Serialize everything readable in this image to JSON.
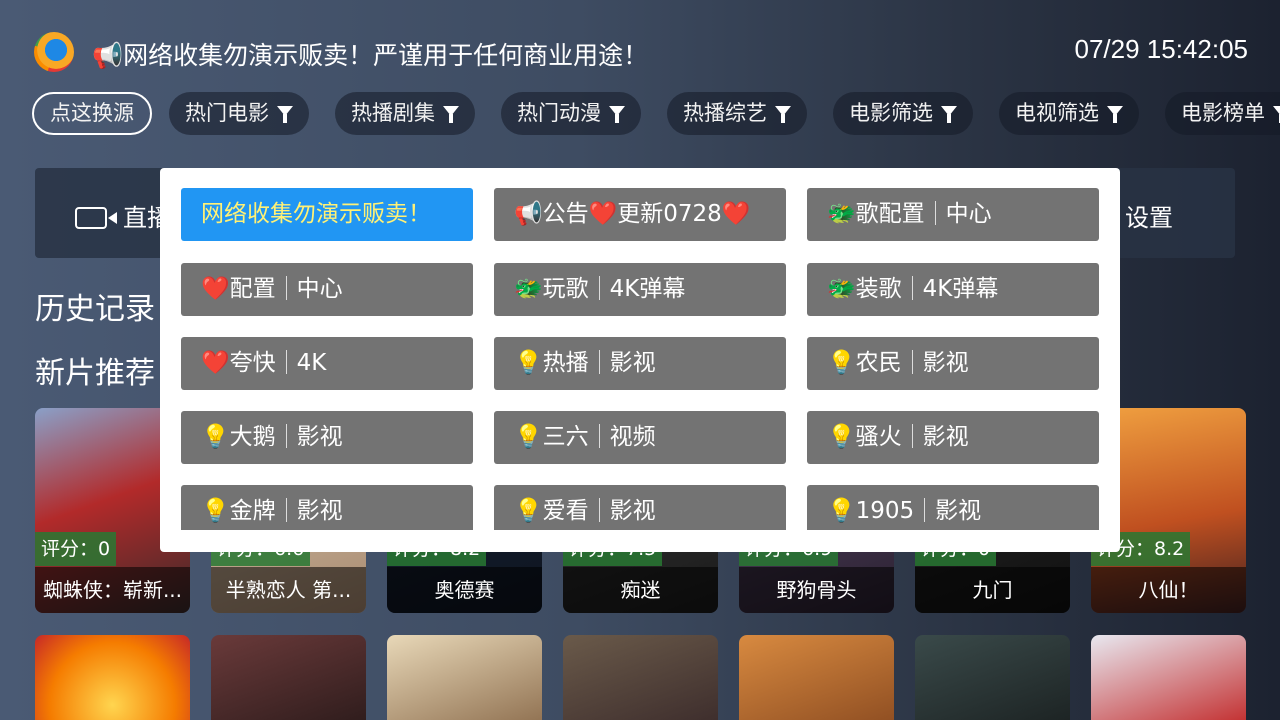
{
  "header": {
    "notice": "📢网络收集勿演示贩卖！严谨用于任何商业用途！",
    "clock": "07/29 15:42:05"
  },
  "tabs": [
    {
      "label": "点这换源",
      "filter": false
    },
    {
      "label": "热门电影",
      "filter": true
    },
    {
      "label": "热播剧集",
      "filter": true
    },
    {
      "label": "热门动漫",
      "filter": true
    },
    {
      "label": "热播综艺",
      "filter": true
    },
    {
      "label": "电影筛选",
      "filter": true
    },
    {
      "label": "电视筛选",
      "filter": true
    },
    {
      "label": "电影榜单",
      "filter": true
    }
  ],
  "navbar": {
    "live": "直播",
    "settings": "设置"
  },
  "sections": {
    "history": "历史记录",
    "new": "新片推荐"
  },
  "cards": [
    {
      "title": "蜘蛛侠：崭新...",
      "rating": "评分：0"
    },
    {
      "title": "半熟恋人 第...",
      "rating": "评分：6.6"
    },
    {
      "title": "奥德赛",
      "rating": "评分：8.2"
    },
    {
      "title": "痴迷",
      "rating": "评分：7.5"
    },
    {
      "title": "野狗骨头",
      "rating": "评分：6.9"
    },
    {
      "title": "九门",
      "rating": "评分：0"
    },
    {
      "title": "八仙！",
      "rating": "评分：8.2"
    }
  ],
  "sources": [
    {
      "left": "网络收集勿演示贩卖！",
      "right": ""
    },
    {
      "left": "📢公告❤️更新0728❤️",
      "right": ""
    },
    {
      "left": "🐲歌配置",
      "right": "中心"
    },
    {
      "left": "❤️配置",
      "right": "中心"
    },
    {
      "left": "🐲玩歌",
      "right": "4K弹幕"
    },
    {
      "left": "🐲装歌",
      "right": "4K弹幕"
    },
    {
      "left": "❤️夸快",
      "right": "4K"
    },
    {
      "left": "💡热播",
      "right": "影视"
    },
    {
      "left": "💡农民",
      "right": "影视"
    },
    {
      "left": "💡大鹅",
      "right": "影视"
    },
    {
      "left": "💡三六",
      "right": "视频"
    },
    {
      "left": "💡骚火",
      "right": "影视"
    },
    {
      "left": "💡金牌",
      "right": "影视"
    },
    {
      "left": "💡爱看",
      "right": "影视"
    },
    {
      "left": "💡1905",
      "right": "影视"
    }
  ]
}
